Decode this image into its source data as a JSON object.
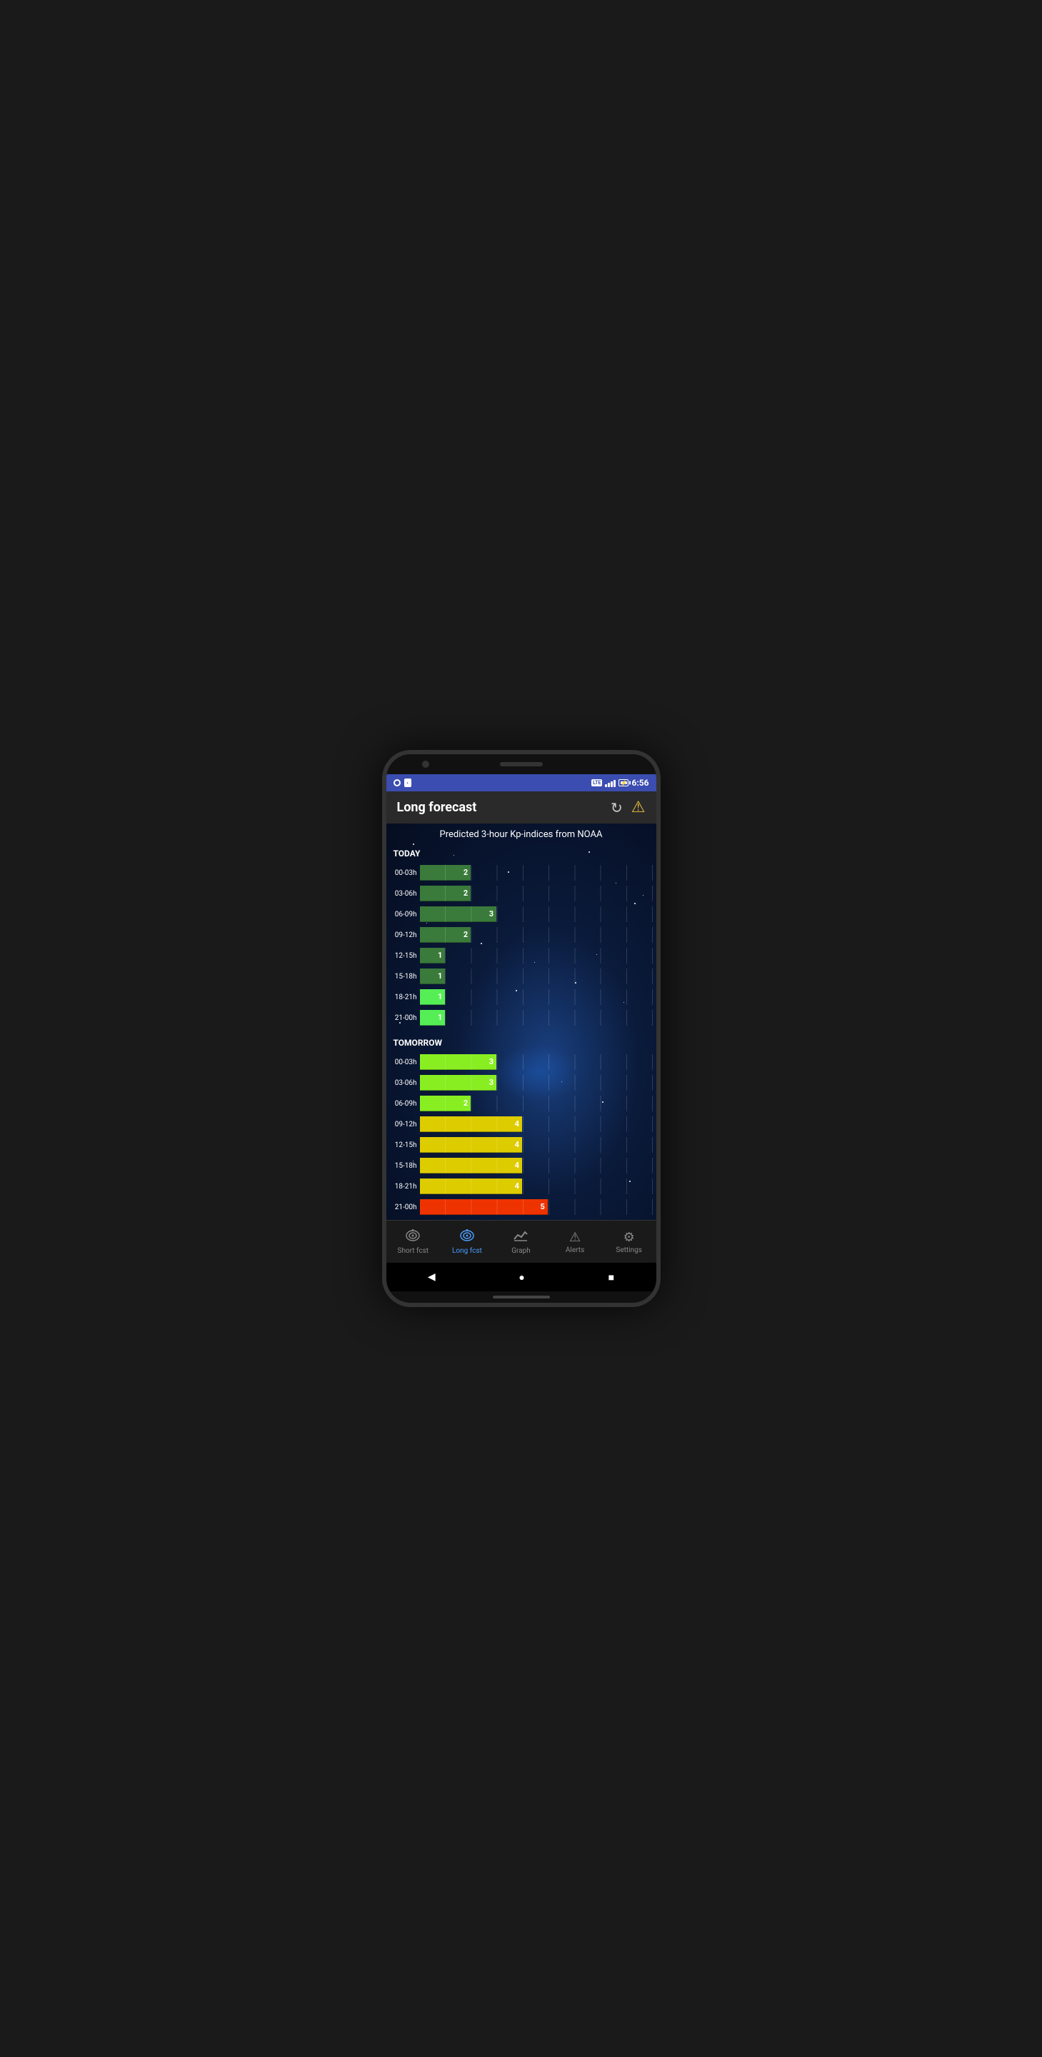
{
  "status_bar": {
    "time": "6:56",
    "lte": "LTE"
  },
  "header": {
    "title": "Long forecast",
    "refresh_label": "refresh",
    "warning_label": "warning"
  },
  "chart": {
    "title": "Predicted 3-hour Kp-indices from NOAA",
    "sections": [
      {
        "label": "TODAY",
        "rows": [
          {
            "time": "00-03h",
            "value": 2,
            "color": "#3a7a3a",
            "width_pct": 22
          },
          {
            "time": "03-06h",
            "value": 2,
            "color": "#3a7a3a",
            "width_pct": 22
          },
          {
            "time": "06-09h",
            "value": 3,
            "color": "#3a7a3a",
            "width_pct": 33
          },
          {
            "time": "09-12h",
            "value": 2,
            "color": "#3a7a3a",
            "width_pct": 22
          },
          {
            "time": "12-15h",
            "value": 1,
            "color": "#3a7a3a",
            "width_pct": 11
          },
          {
            "time": "15-18h",
            "value": 1,
            "color": "#3a7a3a",
            "width_pct": 11
          },
          {
            "time": "18-21h",
            "value": 1,
            "color": "#55ee55",
            "width_pct": 11
          },
          {
            "time": "21-00h",
            "value": 1,
            "color": "#55ee55",
            "width_pct": 11
          }
        ]
      },
      {
        "label": "TOMORROW",
        "rows": [
          {
            "time": "00-03h",
            "value": 3,
            "color": "#88ee22",
            "width_pct": 33
          },
          {
            "time": "03-06h",
            "value": 3,
            "color": "#88ee22",
            "width_pct": 33
          },
          {
            "time": "06-09h",
            "value": 2,
            "color": "#88ee22",
            "width_pct": 22
          },
          {
            "time": "09-12h",
            "value": 4,
            "color": "#ddcc00",
            "width_pct": 44
          },
          {
            "time": "12-15h",
            "value": 4,
            "color": "#ddcc00",
            "width_pct": 44
          },
          {
            "time": "15-18h",
            "value": 4,
            "color": "#ddcc00",
            "width_pct": 44
          },
          {
            "time": "18-21h",
            "value": 4,
            "color": "#ddcc00",
            "width_pct": 44
          },
          {
            "time": "21-00h",
            "value": 5,
            "color": "#ee3300",
            "width_pct": 55
          }
        ]
      }
    ]
  },
  "bottom_nav": {
    "items": [
      {
        "id": "short-fcst",
        "label": "Short fcst",
        "active": false,
        "icon": "📡"
      },
      {
        "id": "long-fcst",
        "label": "Long fcst",
        "active": true,
        "icon": "📡"
      },
      {
        "id": "graph",
        "label": "Graph",
        "active": false,
        "icon": "📈"
      },
      {
        "id": "alerts",
        "label": "Alerts",
        "active": false,
        "icon": "⚠"
      },
      {
        "id": "settings",
        "label": "Settings",
        "active": false,
        "icon": "⚙"
      }
    ]
  },
  "system_nav": {
    "back": "◀",
    "home": "●",
    "recent": "■"
  }
}
